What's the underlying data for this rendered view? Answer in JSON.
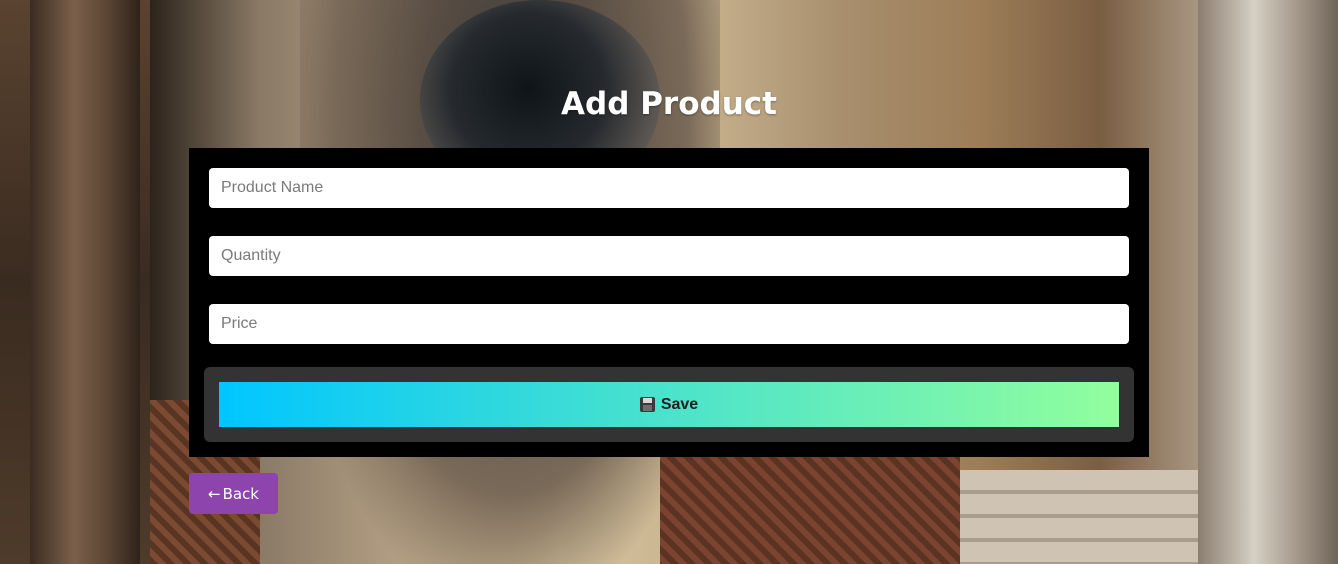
{
  "page": {
    "title": "Add Product"
  },
  "form": {
    "fields": [
      {
        "name": "product-name",
        "placeholder": "Product Name",
        "value": ""
      },
      {
        "name": "quantity",
        "placeholder": "Quantity",
        "value": ""
      },
      {
        "name": "price",
        "placeholder": "Price",
        "value": ""
      }
    ],
    "save": {
      "icon": "floppy-disk-icon",
      "label": "Save"
    }
  },
  "navigation": {
    "back": {
      "arrow": "←",
      "label": "Back"
    }
  },
  "colors": {
    "card": "#000000",
    "save_area": "#333333",
    "save_gradient_start": "#00c6ff",
    "save_gradient_end": "#92fe9d",
    "back_button": "#8e44ad",
    "title": "#ffffff"
  }
}
